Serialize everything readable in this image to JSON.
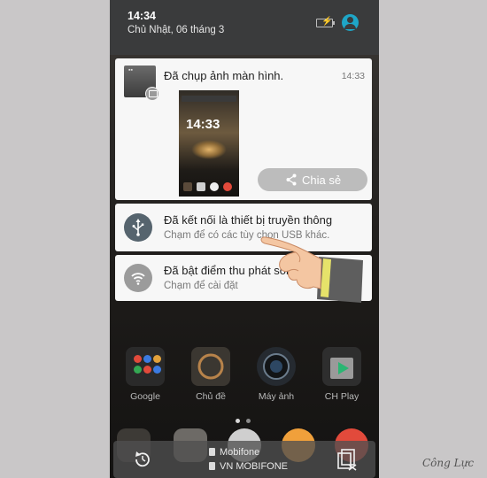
{
  "status_bar": {
    "time": "14:34",
    "date": "Chủ Nhật, 06 tháng 3"
  },
  "notifications": {
    "screenshot": {
      "title": "Đã chụp ảnh màn hình.",
      "time": "14:33",
      "preview_time": "14:33",
      "share_label": "Chia sẻ"
    },
    "usb": {
      "title": "Đã kết nối là thiết bị truyền thông",
      "subtitle": "Chạm để có các tùy chọn USB khác."
    },
    "hotspot": {
      "title": "Đã bật điểm thu phát sóng",
      "subtitle": "Chạm để cài đặt"
    }
  },
  "home_apps": [
    {
      "label": "Google",
      "icon": "google-folder-icon"
    },
    {
      "label": "Chủ đề",
      "icon": "theme-icon"
    },
    {
      "label": "Máy ảnh",
      "icon": "camera-icon"
    },
    {
      "label": "CH Play",
      "icon": "play-store-icon"
    }
  ],
  "carriers": [
    "Mobifone",
    "VN MOBIFONE"
  ],
  "watermark": "Công Lực",
  "colors": {
    "accent": "#1ea6c7",
    "usb_icon_bg": "#56646e",
    "hotspot_icon_bg": "#9b9b9b",
    "share_button_bg": "#bcbcbc",
    "card_bg": "#f7f7f7"
  }
}
